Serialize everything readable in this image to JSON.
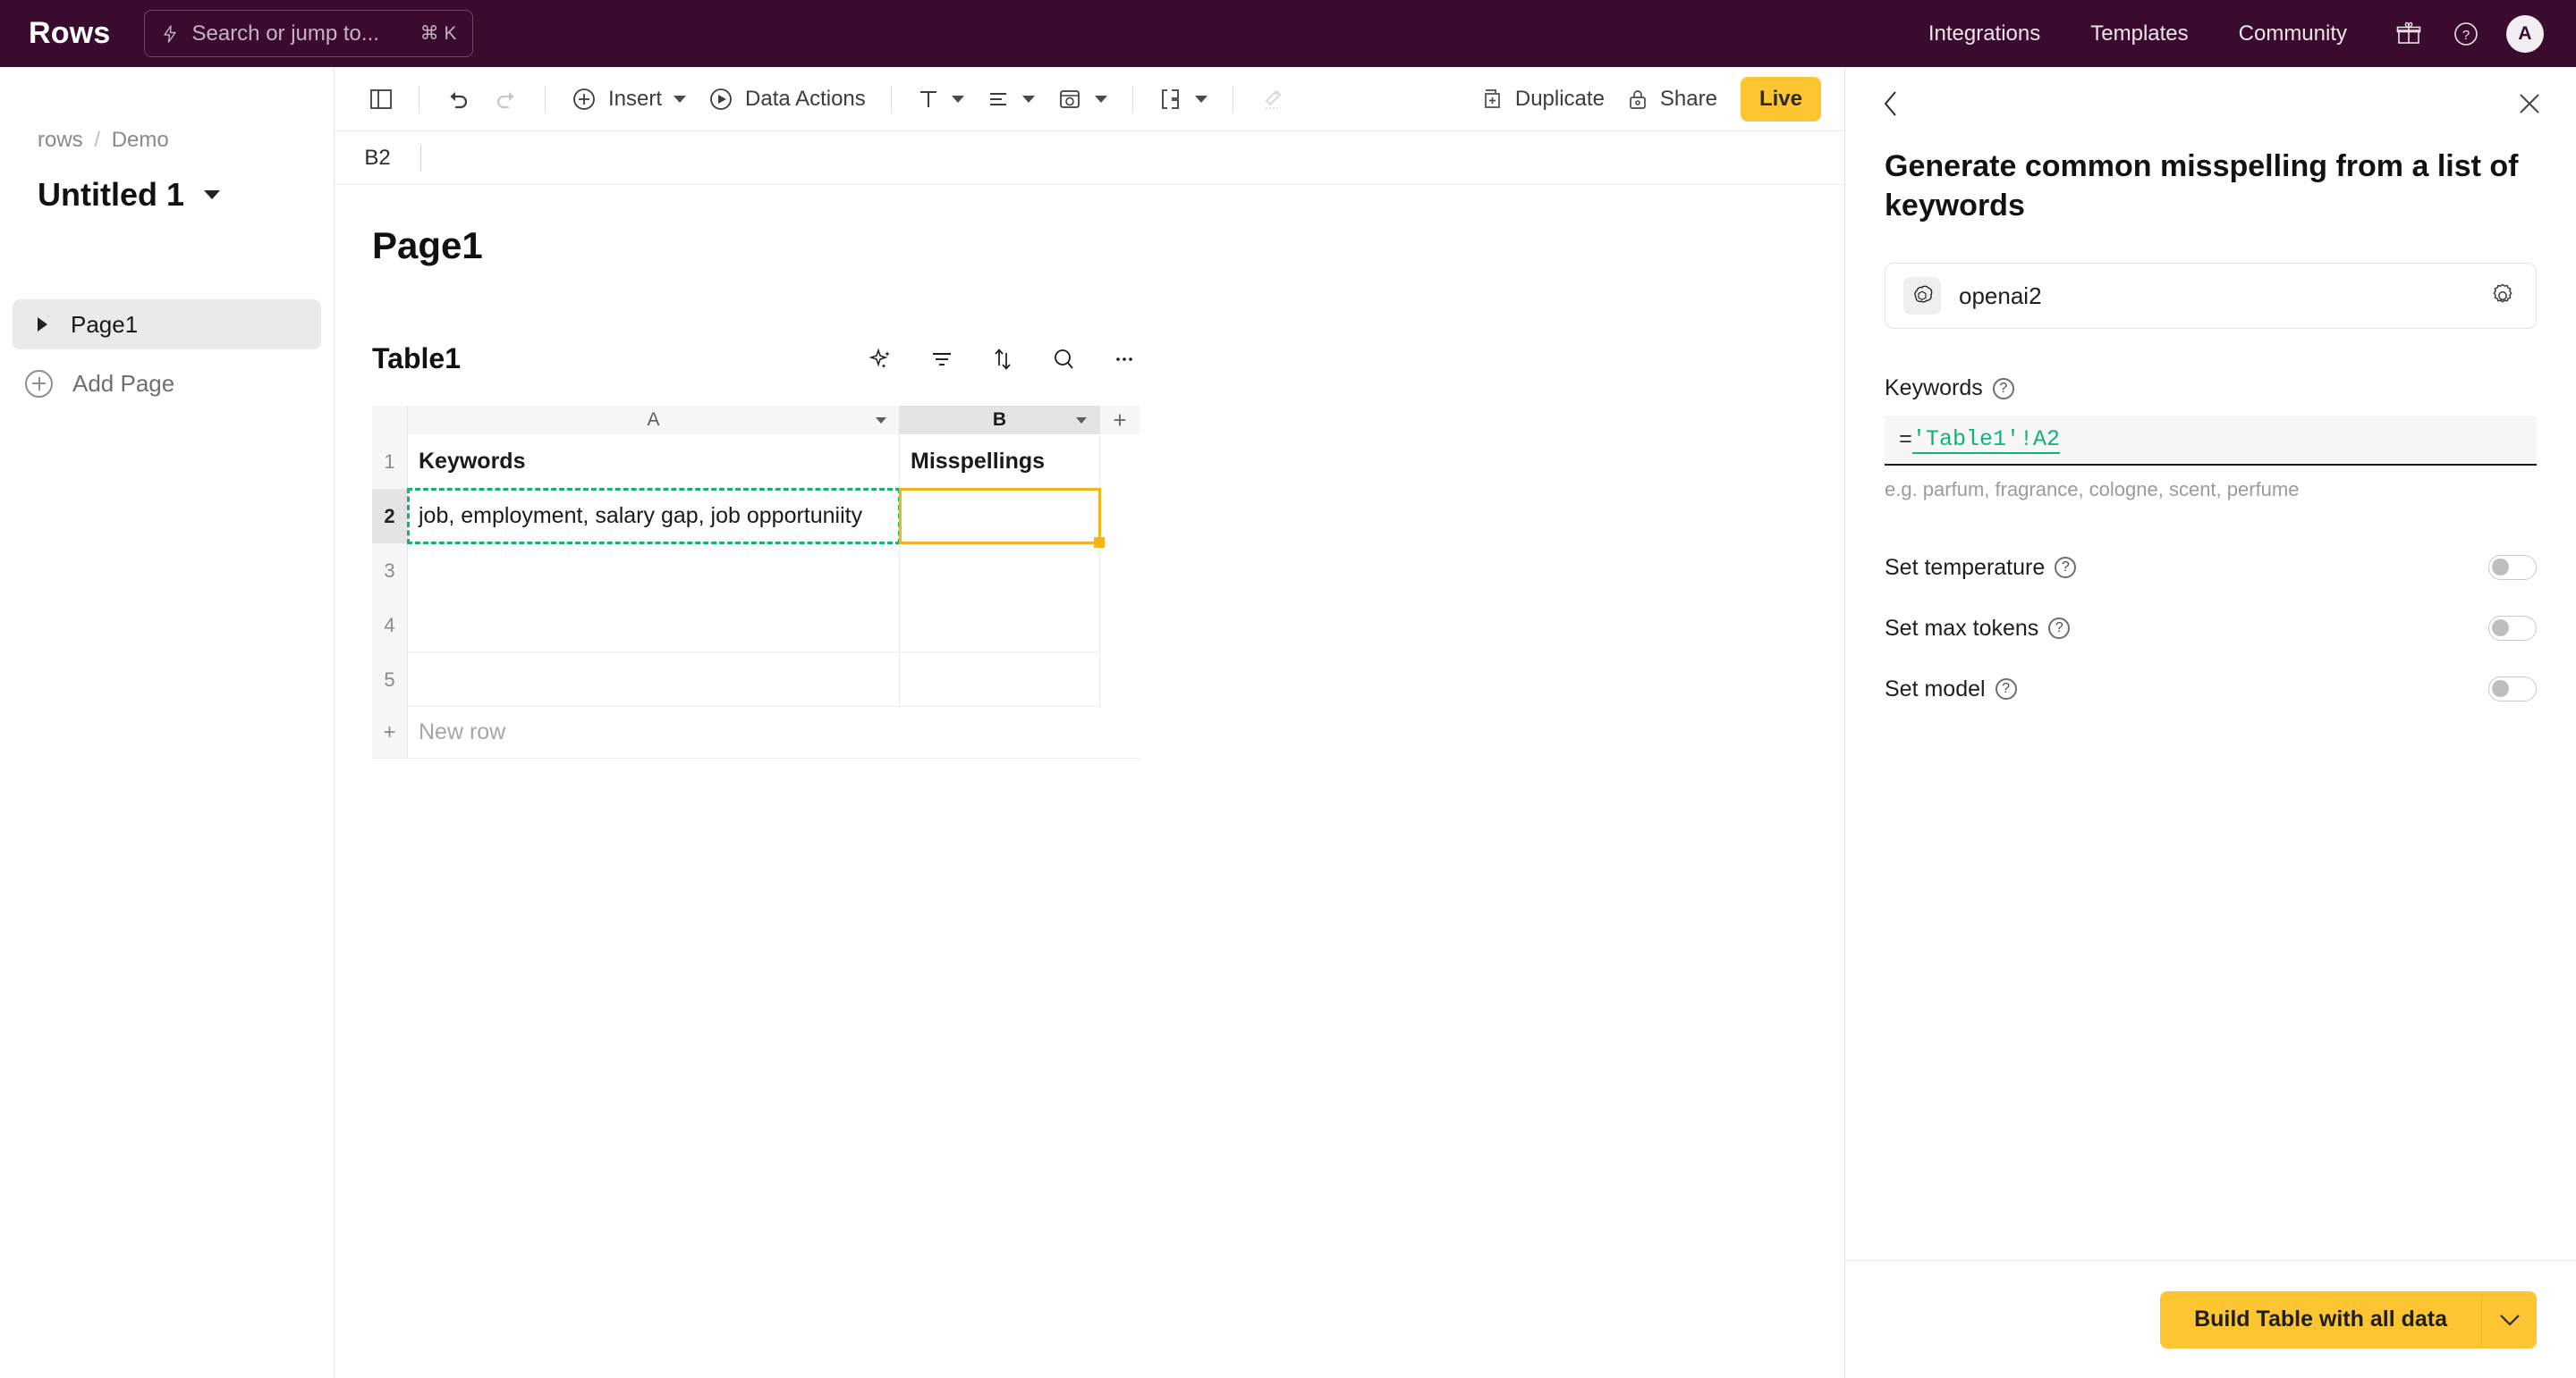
{
  "topnav": {
    "brand": "Rows",
    "search": {
      "placeholder": "Search or jump to...",
      "shortcut": "⌘ K",
      "icon": "bolt-icon"
    },
    "links": [
      {
        "label": "Integrations"
      },
      {
        "label": "Templates"
      },
      {
        "label": "Community"
      }
    ],
    "gift_icon": "gift-icon",
    "help_icon": "question-circle-icon",
    "avatar_initial": "A"
  },
  "sidebar": {
    "breadcrumb": {
      "workspace": "rows",
      "separator": "/",
      "folder": "Demo"
    },
    "doc_title": "Untitled 1",
    "pages": [
      {
        "label": "Page1"
      }
    ],
    "add_page_label": "Add Page"
  },
  "toolbar": {
    "panel_toggle_icon": "sidebar-toggle-icon",
    "undo_icon": "undo-icon",
    "redo_icon": "redo-icon",
    "insert_label": "Insert",
    "data_actions_label": "Data Actions",
    "text_format_icon": "text-format-icon",
    "align_icon": "align-icon",
    "color_icon": "cell-color-icon",
    "borders_icon": "borders-icon",
    "clear_format_icon": "clear-formatting-icon",
    "duplicate_label": "Duplicate",
    "share_label": "Share",
    "live_label": "Live",
    "live_color": "#FCC531"
  },
  "formula_bar": {
    "cell_ref": "B2",
    "value": ""
  },
  "canvas": {
    "page_heading": "Page1",
    "table_name": "Table1",
    "table_tools": [
      {
        "icon": "ai-sparkle-icon"
      },
      {
        "icon": "filter-icon"
      },
      {
        "icon": "sort-icon"
      },
      {
        "icon": "search-icon"
      },
      {
        "icon": "more-options-icon"
      }
    ]
  },
  "grid": {
    "columns": [
      {
        "letter": "A",
        "active": false
      },
      {
        "letter": "B",
        "active": true
      }
    ],
    "add_column_label": "+",
    "rows": [
      {
        "number": "1",
        "cells": [
          "Keywords",
          "Misspellings"
        ],
        "header": true
      },
      {
        "number": "2",
        "cells": [
          "job, employment, salary gap, job opportuniity",
          ""
        ],
        "header": false
      },
      {
        "number": "3",
        "cells": [
          "",
          ""
        ],
        "header": false
      },
      {
        "number": "4",
        "cells": [
          "",
          ""
        ],
        "header": false
      },
      {
        "number": "5",
        "cells": [
          "",
          ""
        ],
        "header": false
      }
    ],
    "new_row_label": "New row",
    "new_row_plus": "+",
    "source_selection": {
      "cell": "A2",
      "color": "#15B26B"
    },
    "active_selection": {
      "cell": "B2",
      "color": "#F5B518"
    }
  },
  "panel": {
    "back_icon": "chevron-left-icon",
    "close_icon": "close-icon",
    "title": "Generate common misspelling from a list of keywords",
    "integration": {
      "name": "openai2",
      "logo_icon": "openai-icon",
      "settings_icon": "gear-icon"
    },
    "keywords_field": {
      "label": "Keywords",
      "help_icon": "question-icon",
      "value_prefix": "=",
      "value_reference": "'Table1'!A2",
      "helper_text": "e.g. parfum, fragrance, cologne, scent, perfume"
    },
    "settings": [
      {
        "label": "Set temperature",
        "help_icon": "question-icon",
        "enabled": false
      },
      {
        "label": "Set max tokens",
        "help_icon": "question-icon",
        "enabled": false
      },
      {
        "label": "Set model",
        "help_icon": "question-icon",
        "enabled": false
      }
    ],
    "footer": {
      "build_label": "Build Table with all data",
      "dropdown_icon": "chevron-down-icon",
      "button_color": "#FCC531"
    }
  }
}
